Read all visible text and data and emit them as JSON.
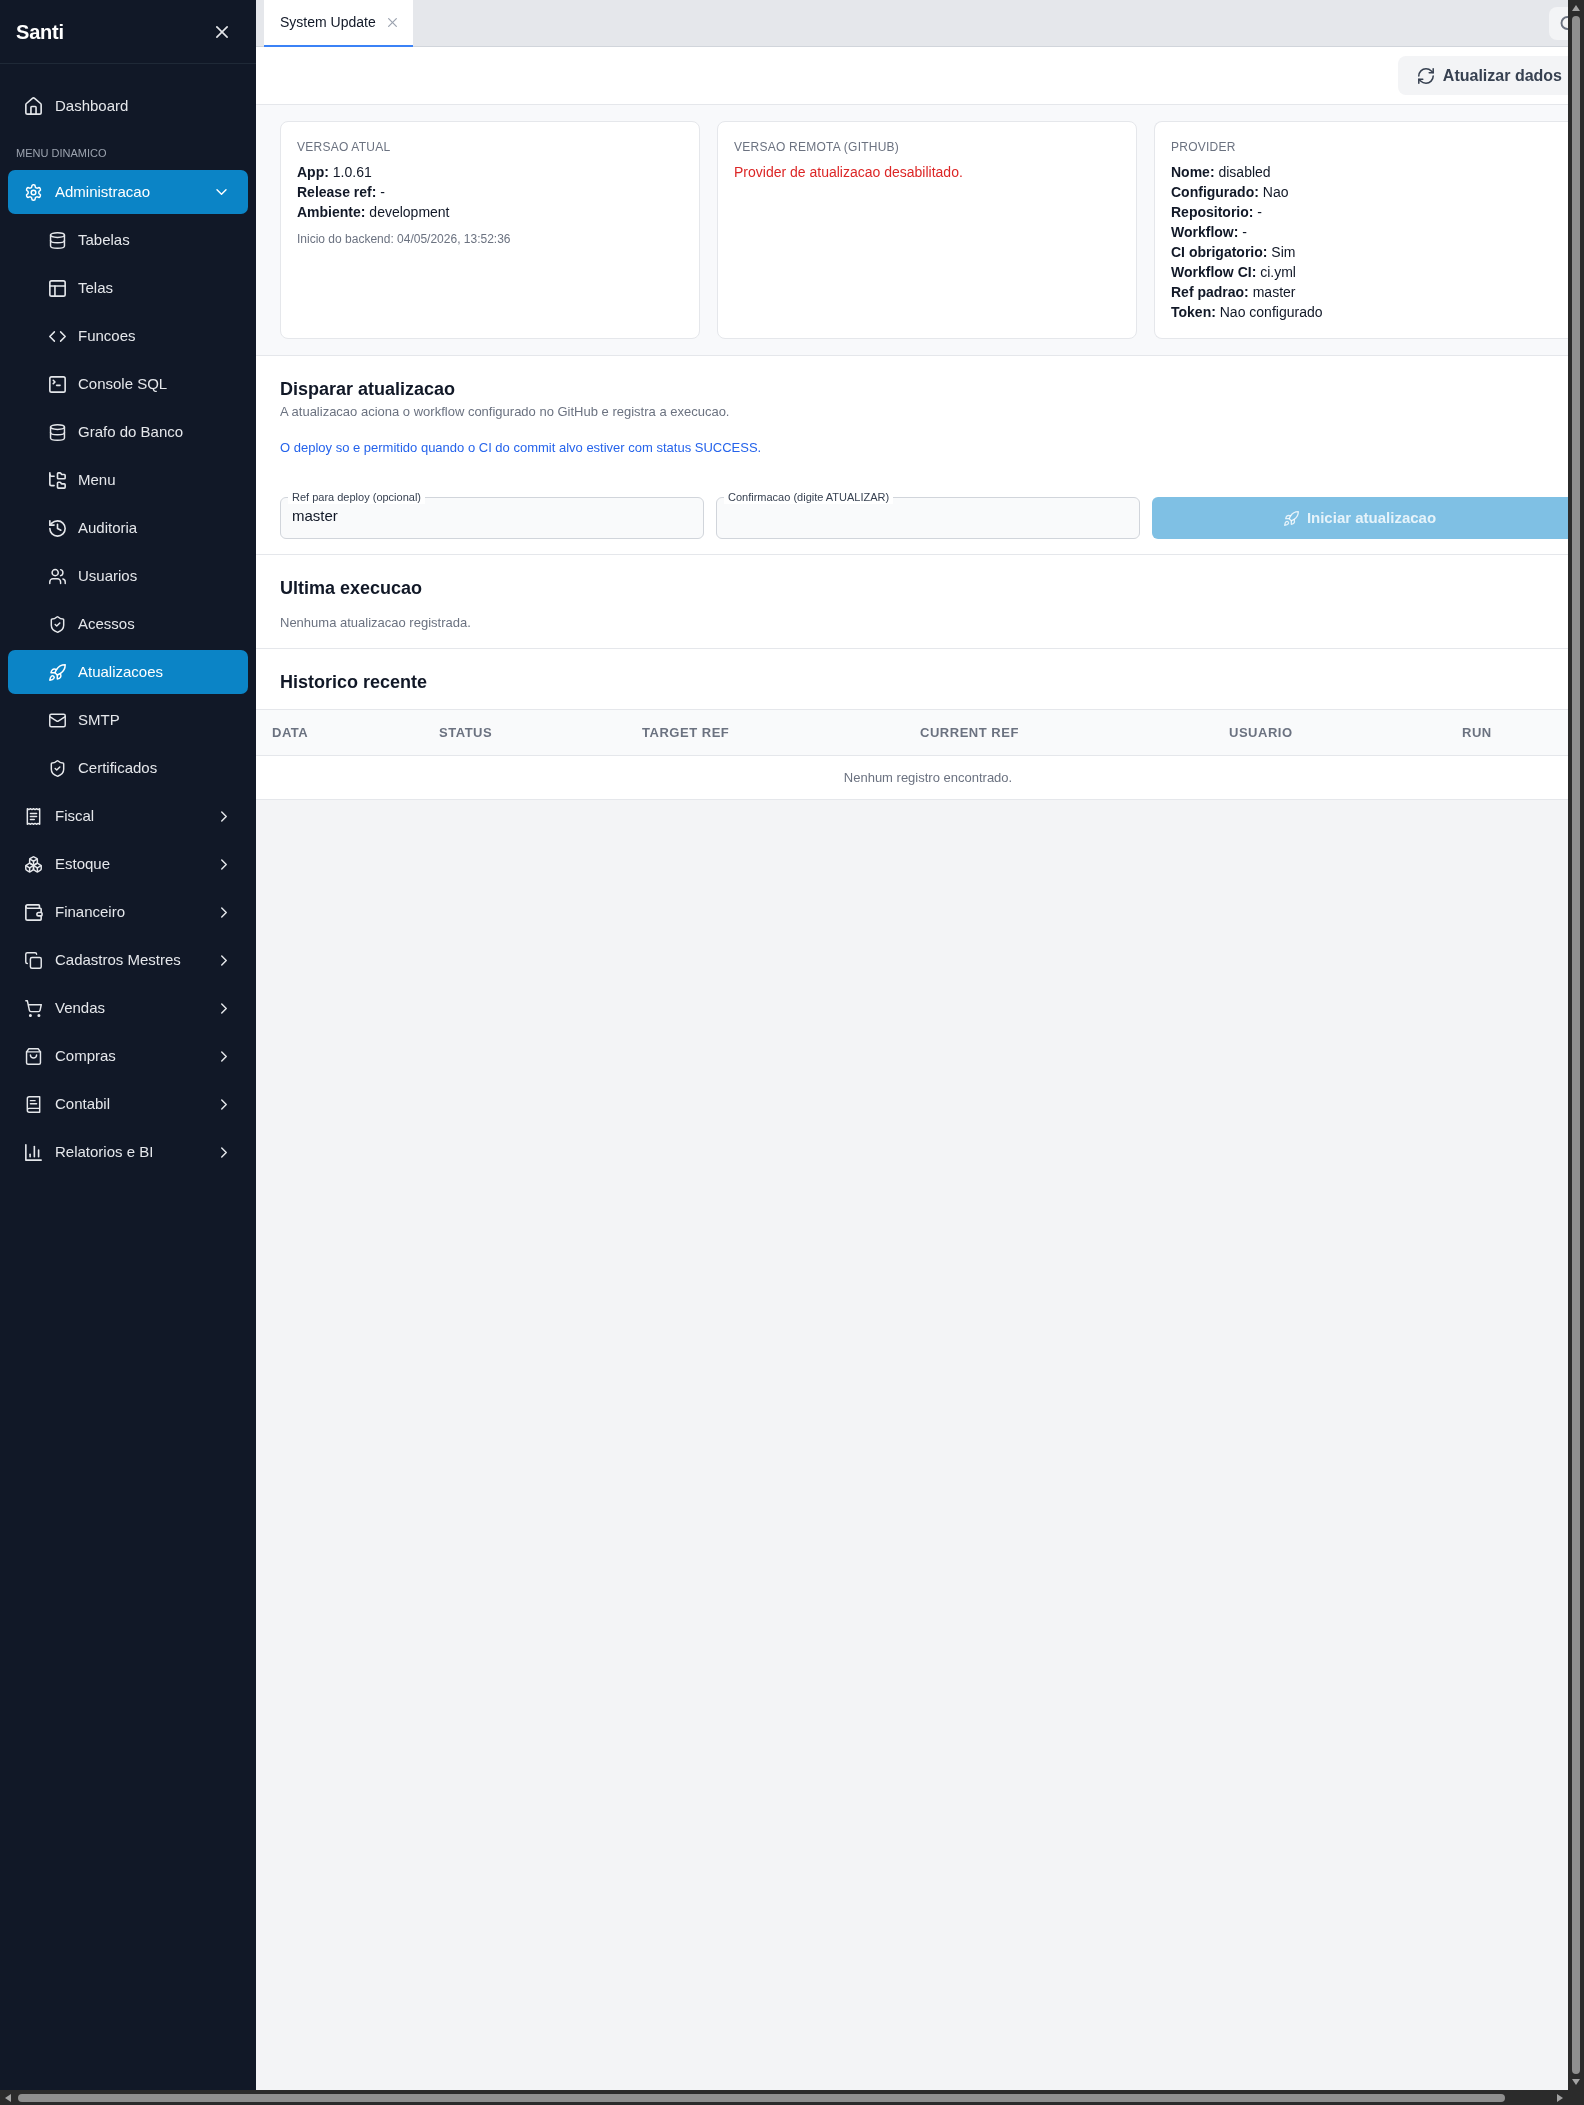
{
  "sidebar": {
    "brand": "Santi",
    "nav": [
      {
        "kind": "link",
        "label": "Dashboard",
        "selected": false
      },
      {
        "kind": "section",
        "label": "MENU DINAMICO"
      },
      {
        "kind": "group",
        "label": "Administracao",
        "selected": true,
        "expanded": true,
        "children": [
          {
            "label": "Tabelas",
            "selected": false
          },
          {
            "label": "Telas",
            "selected": false
          },
          {
            "label": "Funcoes",
            "selected": false
          },
          {
            "label": "Console SQL",
            "selected": false
          },
          {
            "label": "Grafo do Banco",
            "selected": false
          },
          {
            "label": "Menu",
            "selected": false
          },
          {
            "label": "Auditoria",
            "selected": false
          },
          {
            "label": "Usuarios",
            "selected": false
          },
          {
            "label": "Acessos",
            "selected": false
          },
          {
            "label": "Atualizacoes",
            "selected": true
          },
          {
            "label": "SMTP",
            "selected": false
          },
          {
            "label": "Certificados",
            "selected": false
          }
        ]
      },
      {
        "kind": "group",
        "label": "Fiscal",
        "selected": false,
        "expanded": false
      },
      {
        "kind": "group",
        "label": "Estoque",
        "selected": false,
        "expanded": false
      },
      {
        "kind": "group",
        "label": "Financeiro",
        "selected": false,
        "expanded": false
      },
      {
        "kind": "group",
        "label": "Cadastros Mestres",
        "selected": false,
        "expanded": false
      },
      {
        "kind": "group",
        "label": "Vendas",
        "selected": false,
        "expanded": false
      },
      {
        "kind": "group",
        "label": "Compras",
        "selected": false,
        "expanded": false
      },
      {
        "kind": "group",
        "label": "Contabil",
        "selected": false,
        "expanded": false
      },
      {
        "kind": "group",
        "label": "Relatorios e BI",
        "selected": false,
        "expanded": false
      }
    ]
  },
  "tabs": [
    {
      "label": "System Update",
      "selected": true
    }
  ],
  "toolbar": {
    "refresh_button": "Atualizar dados"
  },
  "cards": [
    {
      "kind": "details",
      "title": "VERSAO ATUAL",
      "lines": [
        "**App:** 1.0.61",
        "**Release ref:** -",
        "**Ambiente:** development"
      ],
      "note": "Inicio do backend: 04/05/2026, 13:52:36"
    },
    {
      "kind": "error",
      "title": "VERSAO REMOTA (GITHUB)",
      "message": "Provider de atualizacao desabilitado."
    },
    {
      "kind": "details",
      "title": "PROVIDER",
      "lines": [
        "**Nome:** disabled",
        "**Configurado:** Nao",
        "**Repositorio:** -",
        "**Workflow:** -",
        "**CI obrigatorio:** Sim",
        "**Workflow CI:** ci.yml",
        "**Ref padrao:** master",
        "**Token:** Nao configurado"
      ]
    }
  ],
  "deploy": {
    "title": "Disparar atualizacao",
    "description": "A atualizacao aciona o workflow configurado no GitHub e registra a execucao.",
    "info": "O deploy so e permitido quando o CI do commit alvo estiver com status SUCCESS.",
    "fields": [
      {
        "label": "Ref para deploy (opcional)",
        "value": "master"
      },
      {
        "label": "Confirmacao (digite ATUALIZAR)"
      }
    ],
    "button": {
      "label": "Iniciar atualizacao",
      "disabled": true
    }
  },
  "last_run": {
    "title": "Ultima execucao",
    "empty_text": "Nenhuma atualizacao registrada."
  },
  "history": {
    "title": "Historico recente",
    "columns": [
      "DATA",
      "STATUS",
      "TARGET REF",
      "CURRENT REF",
      "USUARIO",
      "RUN"
    ],
    "empty_text": "Nenhum registro encontrado."
  }
}
